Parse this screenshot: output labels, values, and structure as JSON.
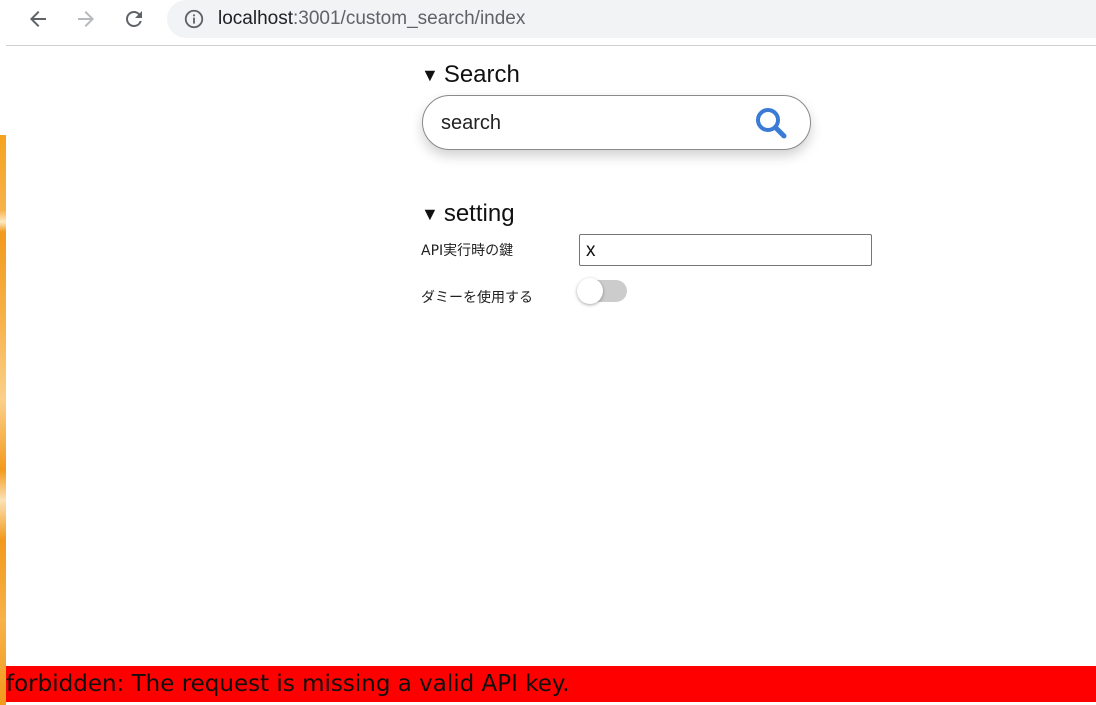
{
  "browser": {
    "url_host": "localhost",
    "url_rest": ":3001/custom_search/index",
    "icons": {
      "back": "arrow-left-icon",
      "forward": "arrow-right-icon",
      "reload": "reload-icon",
      "info": "info-icon"
    }
  },
  "search_section": {
    "marker": "▼",
    "title": "Search",
    "input_value": "search",
    "icon": "search-icon",
    "icon_color": "#3b7bd6"
  },
  "setting_section": {
    "marker": "▼",
    "title": "setting",
    "api_key_label": "API実行時の鍵",
    "api_key_value": "x",
    "dummy_label": "ダミーを使用する",
    "dummy_enabled": false
  },
  "error": {
    "message": "forbidden: The request is missing a valid API key.",
    "color": "#ff0000"
  }
}
